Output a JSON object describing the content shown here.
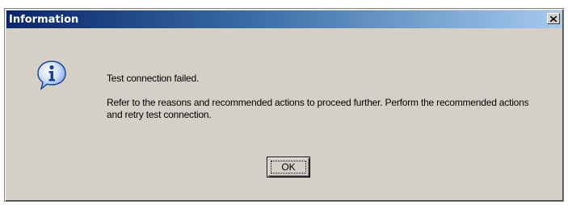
{
  "dialog": {
    "title": "Information",
    "close_icon": "close-icon",
    "icon": "info-icon",
    "message_primary": "Test connection failed.",
    "message_secondary": "Refer to the reasons and recommended actions to proceed further. Perform the recommended actions and retry test connection.",
    "ok_label": "OK"
  },
  "colors": {
    "face": "#d4d0c8",
    "titlebar_start": "#0a246a",
    "titlebar_end": "#a6caf0",
    "icon_blue": "#2a6fd6"
  }
}
